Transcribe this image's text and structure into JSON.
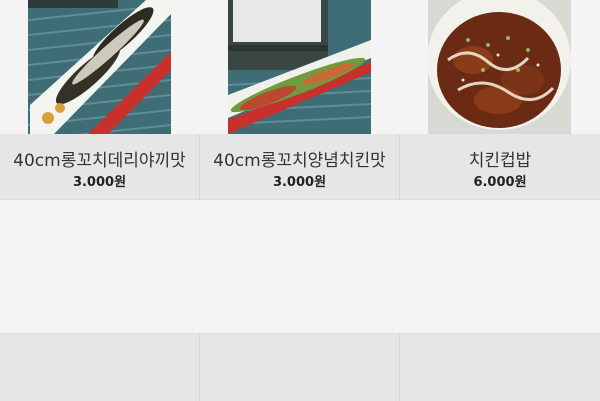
{
  "products": [
    {
      "name": "40cm롱꼬치데리야끼맛",
      "price": "3.000원",
      "image": "teriyaki-skewer-photo"
    },
    {
      "name": "40cm롱꼬치양념치킨맛",
      "price": "3.000원",
      "image": "spicy-chicken-skewer-photo"
    },
    {
      "name": "치킨컵밥",
      "price": "6.000원",
      "image": "chicken-cupbap-photo"
    }
  ],
  "colors": {
    "background": "#f4f4f4",
    "info_panel": "#e6e6e6",
    "text": "#333333"
  }
}
